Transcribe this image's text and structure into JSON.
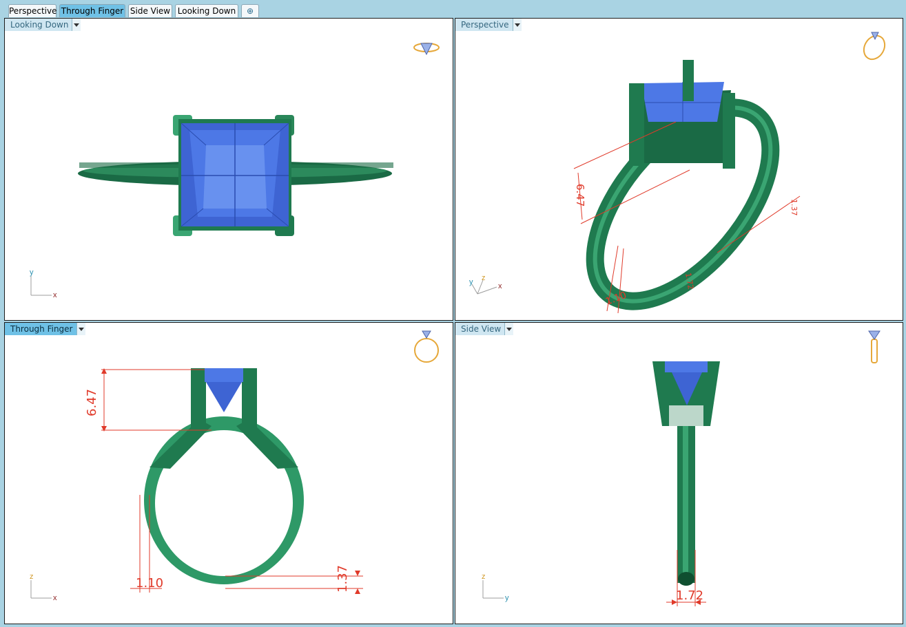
{
  "tabs": [
    {
      "label": "Perspective"
    },
    {
      "label": "Through Finger",
      "active": true
    },
    {
      "label": "Side View"
    },
    {
      "label": "Looking Down"
    }
  ],
  "add_tab_symbol": "⊕",
  "viewports": {
    "top_left": {
      "title": "Looking Down",
      "active": false
    },
    "top_right": {
      "title": "Perspective",
      "active": false
    },
    "bottom_left": {
      "title": "Through Finger",
      "active": true
    },
    "bottom_right": {
      "title": "Side View",
      "active": false
    }
  },
  "axes": {
    "top_left": {
      "a": "y",
      "b": "x"
    },
    "top_right": {
      "a": "y",
      "b": "z",
      "c": "x"
    },
    "bottom_left": {
      "a": "z",
      "b": "x"
    },
    "bottom_right": {
      "a": "z",
      "b": "y"
    }
  },
  "dimensions": {
    "perspective": {
      "height": "6.47",
      "shank": "1.10",
      "top": "1.37",
      "side": "1.72"
    },
    "through_finger": {
      "height": "6.47",
      "shank": "1.10",
      "bottom": "1.37"
    },
    "side_view": {
      "width": "1.72"
    }
  },
  "colors": {
    "metal": "#1f7a4f",
    "metal_light": "#3fae7a",
    "gem": "#4d78e6",
    "dimension": "#e03a2a",
    "accent": "#6fc1e6"
  }
}
